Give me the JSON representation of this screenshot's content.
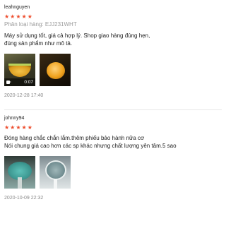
{
  "colors": {
    "star": "#ee4d2d",
    "username": "#222222",
    "variant": "#9a9a9a",
    "timestamp": "#8a8a8a"
  },
  "reviews": [
    {
      "username": "leahnguyen",
      "rating": 5,
      "variant": "Phân loại hàng: EJJ231WHT",
      "comment_lines": [
        "Máy sử dụng tốt, giá cả hợp lý. Shop giao hàng đúng hẹn,",
        "đúng sản phẩm như mô tả."
      ],
      "media": [
        {
          "kind": "video",
          "duration": "0:07",
          "icon": "video-camera-icon"
        },
        {
          "kind": "photo"
        }
      ],
      "timestamp": "2020-12-28 17:40"
    },
    {
      "username": "johnny94",
      "rating": 5,
      "comment_lines": [
        "Đóng hàng chắc chắn lắm.thêm phiếu bảo hành nữa cơ",
        "Nói chung giá cao hơn các sp khác nhưng chất lượng yên tâm.5 sao"
      ],
      "media": [
        {
          "kind": "photo"
        },
        {
          "kind": "photo"
        }
      ],
      "timestamp": "2020-10-09 22:32"
    }
  ]
}
